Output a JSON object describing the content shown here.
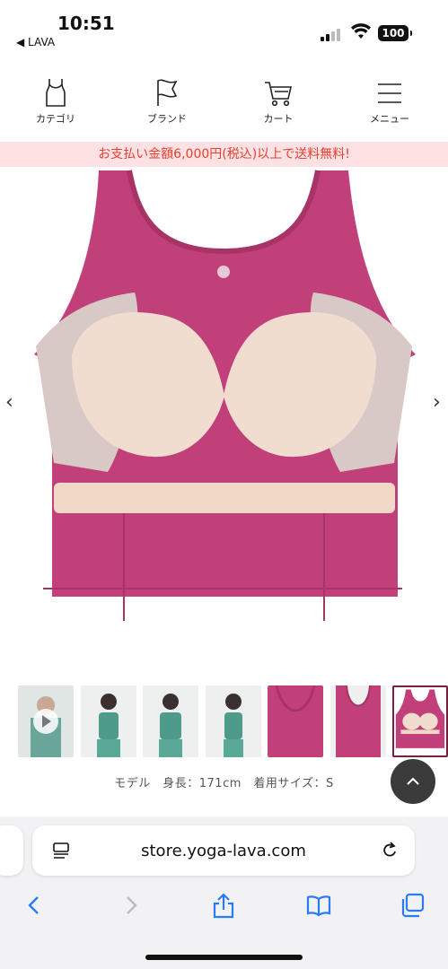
{
  "status_bar": {
    "time": "10:51",
    "back_label": "◀ LAVA",
    "battery": "100"
  },
  "nav": {
    "items": [
      {
        "label": "カテゴリ",
        "icon": "tank-top-icon"
      },
      {
        "label": "ブランド",
        "icon": "flag-icon"
      },
      {
        "label": "カート",
        "icon": "cart-icon"
      },
      {
        "label": "メニュー",
        "icon": "hamburger-menu-icon"
      }
    ]
  },
  "banner": {
    "text": "お支払い金額6,000円(税込)以上で送料無料!"
  },
  "gallery": {
    "prev": "‹",
    "next": "›",
    "thumbnails": [
      {
        "kind": "video",
        "selected": false
      },
      {
        "kind": "model-front",
        "selected": false
      },
      {
        "kind": "model-back",
        "selected": false
      },
      {
        "kind": "model-side",
        "selected": false
      },
      {
        "kind": "detail-neck",
        "selected": false
      },
      {
        "kind": "detail-back",
        "selected": false
      },
      {
        "kind": "detail-bra",
        "selected": true
      }
    ]
  },
  "model_info": "モデル　身長：171cm　着用サイズ：S",
  "browser": {
    "url": "store.yoga-lava.com"
  },
  "colors": {
    "banner_bg": "#fde1e3",
    "banner_text": "#e5402f",
    "safari_blue": "#2a7bf6",
    "product_pink": "#c2407a"
  }
}
